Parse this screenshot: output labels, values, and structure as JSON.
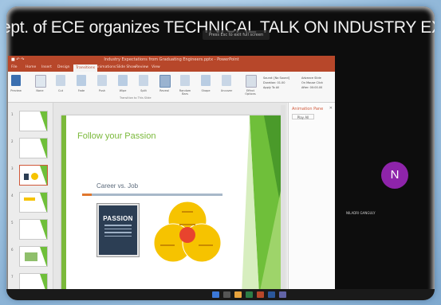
{
  "banner": {
    "text": "ept. of ECE organizes TECHNICAL TALK ON  INDUSTRY EXPECTATIONS FROM",
    "share_hint": "Press  Esc  to exit full screen"
  },
  "powerpoint": {
    "window_title": "Industry Expectations from Graduating Engineers.pptx - PowerPoint",
    "tabs": [
      "File",
      "Home",
      "Insert",
      "Design",
      "Transitions",
      "Animations",
      "Slide Show",
      "Review",
      "View"
    ],
    "active_tab": "Transitions",
    "ribbon_buttons": [
      "Preview",
      "None",
      "Cut",
      "Fade",
      "Push",
      "Wipe",
      "Split",
      "Reveal",
      "Random Bars",
      "Shape",
      "Uncover",
      "Effect Options"
    ],
    "ribbon_group": "Transition to This Slide",
    "timing_options": [
      "Sound: [No Sound]",
      "Duration: 01.00",
      "Apply To All"
    ],
    "advance_options": [
      "Advance Slide",
      "On Mouse Click",
      "After: 00:00.00"
    ],
    "thumbnail_numbers": [
      "1",
      "2",
      "3",
      "4",
      "5",
      "6",
      "7"
    ],
    "slide": {
      "title": "Follow your Passion",
      "subtitle": "Career vs. Job",
      "poster_word": "PASSION"
    },
    "animation_pane": {
      "title": "Animation Pane",
      "play_label": "Play All"
    }
  },
  "participant": {
    "initial": "N",
    "name": "NILADRI GANGULY",
    "avatar_color": "#8e24aa"
  },
  "colors": {
    "ppt_brand": "#b7472a",
    "slide_green": "#7bb93b",
    "venn_yellow": "#f6c300"
  }
}
